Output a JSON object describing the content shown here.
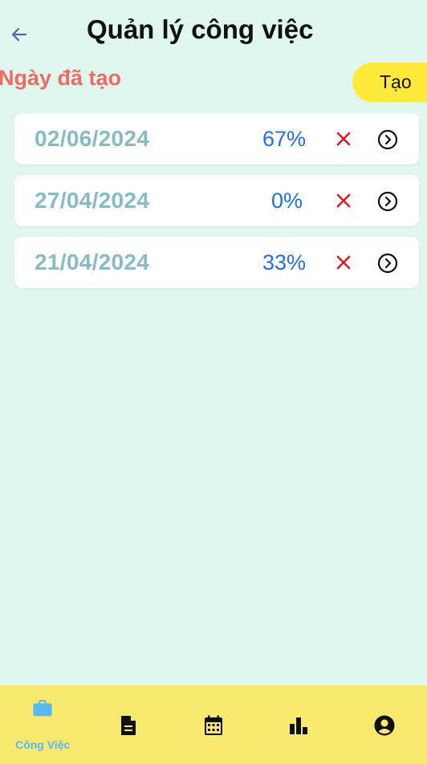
{
  "header": {
    "title": "Quản lý công việc"
  },
  "section": {
    "label": "Ngày đã tạo",
    "create_button": "Tạo"
  },
  "tasks": [
    {
      "date": "02/06/2024",
      "percent": "67%"
    },
    {
      "date": "27/04/2024",
      "percent": "0%"
    },
    {
      "date": "21/04/2024",
      "percent": "33%"
    }
  ],
  "bottom_nav": {
    "items": [
      {
        "label": "Công Việc",
        "icon": "briefcase-icon",
        "active": true
      },
      {
        "label": "",
        "icon": "document-icon",
        "active": false
      },
      {
        "label": "",
        "icon": "calendar-icon",
        "active": false
      },
      {
        "label": "",
        "icon": "bar-chart-icon",
        "active": false
      },
      {
        "label": "",
        "icon": "account-icon",
        "active": false
      }
    ]
  },
  "colors": {
    "background": "#dff7ef",
    "accent_yellow": "#ffe93b",
    "nav_bar": "#f8e96f",
    "section_label": "#ef6b61",
    "date_text": "#88bcc4",
    "percent_text": "#1f70e6",
    "delete_icon": "#e8141b",
    "active_nav": "#56b9f0"
  }
}
